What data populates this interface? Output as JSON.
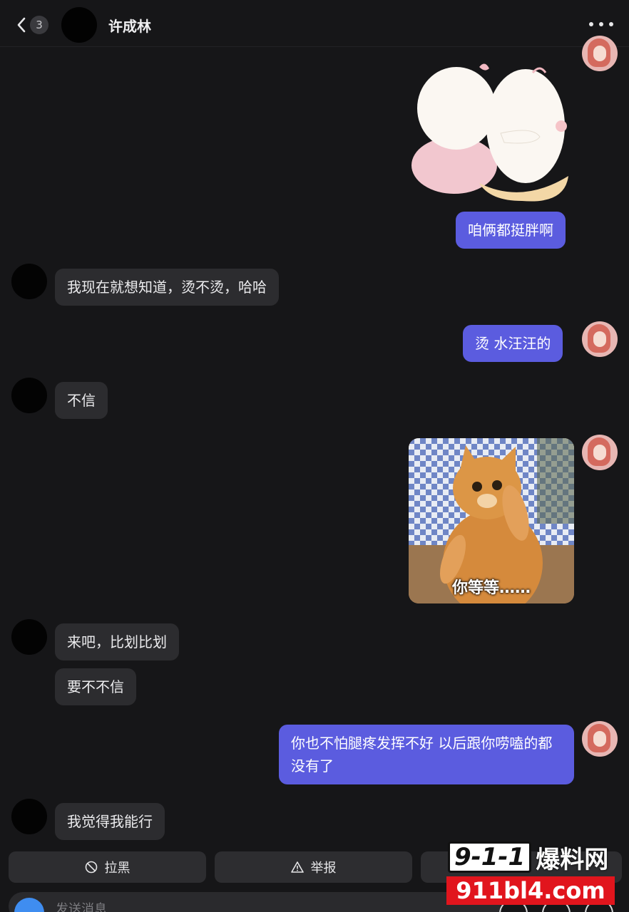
{
  "header": {
    "back_count": "3",
    "contact_name": "许成林"
  },
  "messages": {
    "m1": "咱俩都挺胖啊",
    "m2": "我现在就想知道，烫不烫，哈哈",
    "m3": "烫  水汪汪的",
    "m4": "不信",
    "m5_caption": "你等等……",
    "m6": "来吧，比划比划",
    "m7": "要不不信",
    "m8": "你也不怕腿疼发挥不好  以后跟你唠嗑的都没有了",
    "m9": "我觉得我能行"
  },
  "actions": {
    "block": "拉黑",
    "report": "举报"
  },
  "input": {
    "placeholder": "发送消息"
  },
  "watermark": {
    "top_num": "9-1-1",
    "top_cn": "爆料网",
    "bottom": "911bl4.com"
  },
  "colors": {
    "background": "#161618",
    "bubble_incoming": "#2c2c2f",
    "bubble_outgoing": "#5b5cdf"
  }
}
